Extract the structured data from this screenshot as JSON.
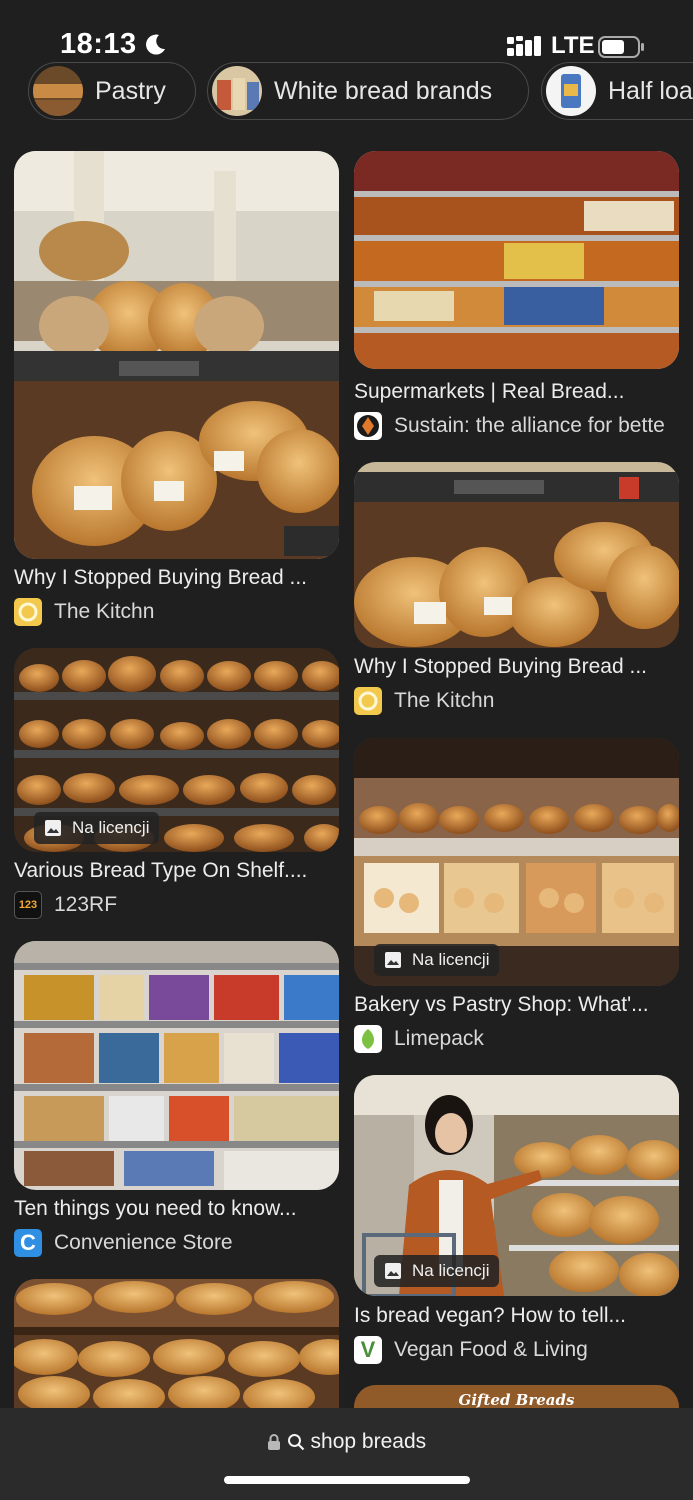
{
  "status_bar": {
    "time": "18:13",
    "network": "LTE"
  },
  "chips": [
    {
      "label": "Pastry"
    },
    {
      "label": "White bread brands"
    },
    {
      "label": "Half loa"
    }
  ],
  "results": [
    {
      "title": "Why I Stopped Buying Bread ...",
      "source": "The Kitchn"
    },
    {
      "title": "Supermarkets | Real Bread...",
      "source": "Sustain: the alliance for bette"
    },
    {
      "title": "Why I Stopped Buying Bread ...",
      "source": "The Kitchn"
    },
    {
      "title": "Various Bread Type On Shelf....",
      "source": "123RF",
      "badge": "Na licencji"
    },
    {
      "title": "Bakery vs Pastry Shop: What'...",
      "source": "Limepack",
      "badge": "Na licencji"
    },
    {
      "title": "Ten things you need to know...",
      "source": "Convenience Store"
    },
    {
      "title": "Is bread vegan? How to tell...",
      "source": "Vegan Food & Living",
      "badge": "Na licencji"
    },
    {
      "title": "",
      "source": ""
    },
    {
      "image_text": "Gifted Breads"
    }
  ],
  "favicons": {
    "kitchn": "#f2c94c",
    "sustain_bg": "#ffffff",
    "rf_text": "123",
    "limepack": "#7cc142",
    "conv": "C",
    "conv_bg": "#2f8fe3",
    "vegan": "V",
    "vegan_fg": "#4a8f3a"
  },
  "address_bar": {
    "text": "shop breads"
  }
}
